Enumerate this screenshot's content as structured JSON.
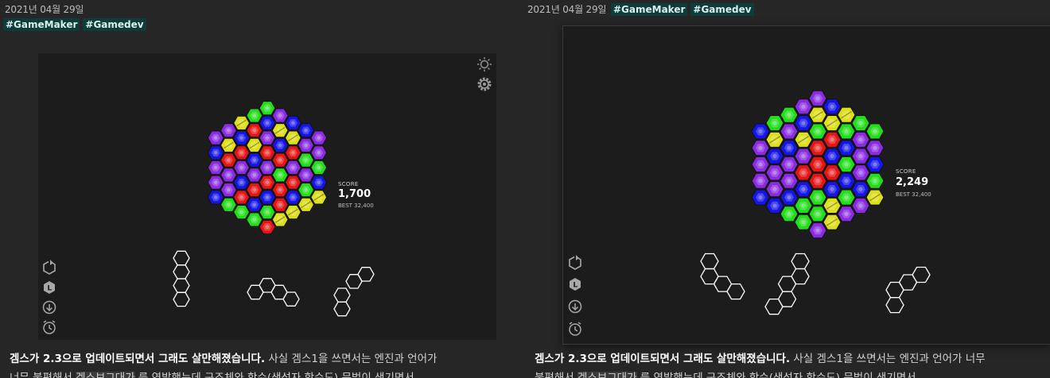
{
  "left": {
    "date": "2021년 04월 29일",
    "tags": [
      "#GameMaker",
      "#Gamedev"
    ],
    "score_label": "SCORE",
    "score": "1,700",
    "best": "BEST 32,400",
    "paragraph": {
      "bold": "겜스가 2.3으로 업데이트되면서 그래도 살만해졌습니다.",
      "line1_rest": " 사실 겜스1을 쓰면서는 엔진과 언어가",
      "line2_a": "너무 불편해서 ",
      "line2_hl": "겜스보그대가",
      "line2_b": " 를 연발했는데 구조체와 함수(생성자 함수도) 문법이 생기면서"
    }
  },
  "right": {
    "date": "2021년 04월 29일",
    "tags": [
      "#GameMaker",
      "#Gamedev"
    ],
    "score_label": "SCORE",
    "score": "2,249",
    "best": "BEST 32,400",
    "paragraph": {
      "bold": "겜스가 2.3으로 업데이트되면서 그래도 살만해졌습니다.",
      "line1_rest": " 사실 겜스1을 쓰면서는 엔진과 언어가 너무",
      "line2_a": "불편해서 ",
      "line2_hl": "겜스보그대가",
      "line2_b": " 를 연발했는데 구조체와 함수(생성자 함수도) 문법이 생기면서"
    }
  },
  "icons": {
    "top": [
      "sun-icon",
      "gear-icon"
    ],
    "side": [
      "restart-hex-icon",
      "level-hex-icon",
      "download-circle-icon",
      "alarm-clock-icon"
    ]
  },
  "colors": {
    "purple": "#8a2be2",
    "blue": "#1515e8",
    "red": "#e51515",
    "green": "#22dd1a",
    "yellow": "#dede1a",
    "background": "#262626",
    "panel": "#1c1c1c",
    "tag_bg": "#0f3b3b"
  },
  "boards": {
    "left": {
      "radius": 4,
      "columns": [
        [
          "P",
          "B",
          "P",
          "P",
          "B"
        ],
        [
          "P",
          "Y",
          "R",
          "P",
          "P",
          "G"
        ],
        [
          "Y",
          "B",
          "R",
          "P",
          "B",
          "R",
          "G"
        ],
        [
          "G",
          "R",
          "Y",
          "B",
          "P",
          "R",
          "B",
          "G"
        ],
        [
          "G",
          "B",
          "P",
          "R",
          "P",
          "R",
          "B",
          "G",
          "R"
        ],
        [
          "P",
          "Y",
          "B",
          "R",
          "G",
          "R",
          "R",
          "Y"
        ],
        [
          "B",
          "Y",
          "R",
          "P",
          "R",
          "B",
          "Y"
        ],
        [
          "B",
          "P",
          "G",
          "P",
          "G",
          "Y"
        ],
        [
          "P",
          "P",
          "G",
          "B",
          "Y"
        ]
      ]
    },
    "right": {
      "radius": 4,
      "columns": [
        [
          "B",
          "P",
          "P",
          "P",
          "B"
        ],
        [
          "G",
          "Y",
          "B",
          "P",
          "P",
          "B"
        ],
        [
          "G",
          "P",
          "B",
          "P",
          "P",
          "B",
          "G"
        ],
        [
          "P",
          "B",
          "Y",
          "P",
          "R",
          "B",
          "G",
          "G"
        ],
        [
          "P",
          "Y",
          "G",
          "R",
          "R",
          "R",
          "G",
          "G",
          "P"
        ],
        [
          "B",
          "Y",
          "R",
          "B",
          "R",
          "B",
          "Y",
          "Y"
        ],
        [
          "Y",
          "G",
          "B",
          "G",
          "B",
          "G",
          "P"
        ],
        [
          "G",
          "P",
          "P",
          "P",
          "B",
          "P"
        ],
        [
          "G",
          "P",
          "B",
          "G",
          "Y"
        ]
      ]
    }
  }
}
